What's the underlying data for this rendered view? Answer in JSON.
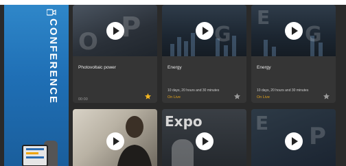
{
  "banner": {
    "word": "CONFERENCE",
    "icon": "video-camera-icon",
    "device_icon": "gimbal-device-icon"
  },
  "cards": [
    {
      "title": "Photovoltaic power",
      "duration": "",
      "status": "",
      "time": "00:00",
      "starred": true,
      "play_icon": "play-icon"
    },
    {
      "title": "Energy",
      "duration": "10 days, 20 hours and 30 minutes",
      "status": "On Live",
      "time": "",
      "starred": false,
      "play_icon": "play-icon"
    },
    {
      "title": "Energy",
      "duration": "10 days, 20 hours and 30 minutes",
      "status": "On Live",
      "time": "",
      "starred": false,
      "play_icon": "play-icon"
    },
    {
      "title": "",
      "play_icon": "play-icon"
    },
    {
      "title": "",
      "thumb_text": "Expo",
      "play_icon": "play-icon"
    },
    {
      "title": "",
      "play_icon": "play-icon"
    }
  ],
  "colors": {
    "star_active": "#f2b520",
    "star_inactive": "#9a9a9a",
    "status": "#e2a21b",
    "banner": "#2f87c9"
  }
}
